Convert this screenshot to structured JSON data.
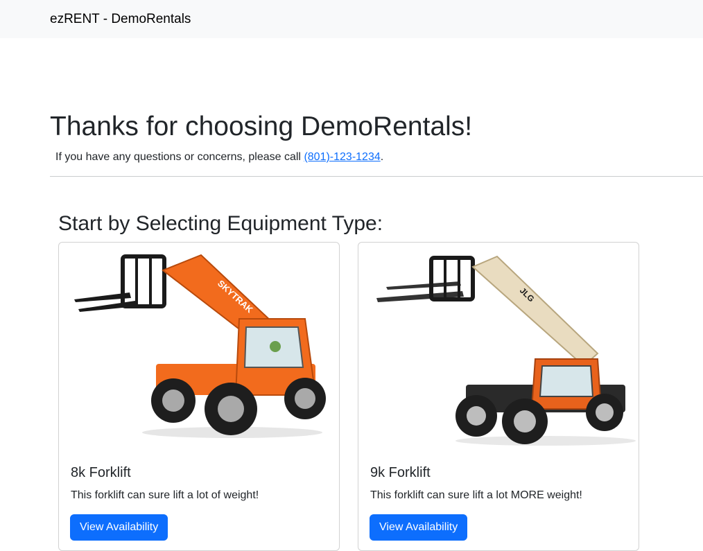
{
  "navbar": {
    "brand": "ezRENT - DemoRentals"
  },
  "hero": {
    "title": "Thanks for choosing DemoRentals!",
    "contact_prefix": "If you have any questions or concerns, please call ",
    "phone": "(801)-123-1234",
    "contact_suffix": "."
  },
  "section": {
    "title": "Start by Selecting Equipment Type:"
  },
  "cards": [
    {
      "title": "8k Forklift",
      "description": "This forklift can sure lift a lot of weight!",
      "button_label": "View Availability",
      "boom_text": "SKYTRAK",
      "body_color": "#f26b1d"
    },
    {
      "title": "9k Forklift",
      "description": "This forklift can sure lift a lot MORE weight!",
      "button_label": "View Availability",
      "boom_text": "JLG",
      "body_color": "#e8621c",
      "boom_color": "#e9dcc0"
    }
  ],
  "colors": {
    "accent": "#0d6efd",
    "navbar_bg": "#f8f9fa"
  }
}
